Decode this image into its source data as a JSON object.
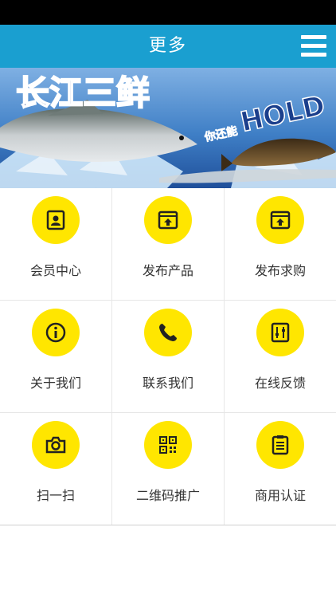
{
  "header": {
    "title": "更多"
  },
  "banner": {
    "title_cn": "长江三鲜",
    "slogan_cn": "你还能",
    "slogan_en": "HOLD"
  },
  "menu": {
    "items": [
      {
        "label": "会员中心",
        "icon": "member-card-icon"
      },
      {
        "label": "发布产品",
        "icon": "upload-window-icon"
      },
      {
        "label": "发布求购",
        "icon": "upload-window-icon"
      },
      {
        "label": "关于我们",
        "icon": "info-icon"
      },
      {
        "label": "联系我们",
        "icon": "phone-icon"
      },
      {
        "label": "在线反馈",
        "icon": "feedback-icon"
      },
      {
        "label": "扫一扫",
        "icon": "camera-icon"
      },
      {
        "label": "二维码推广",
        "icon": "qrcode-icon"
      },
      {
        "label": "商用认证",
        "icon": "clipboard-icon"
      }
    ]
  },
  "colors": {
    "header": "#1a9fd0",
    "icon_circle": "#ffe600",
    "icon_glyph": "#222222"
  }
}
